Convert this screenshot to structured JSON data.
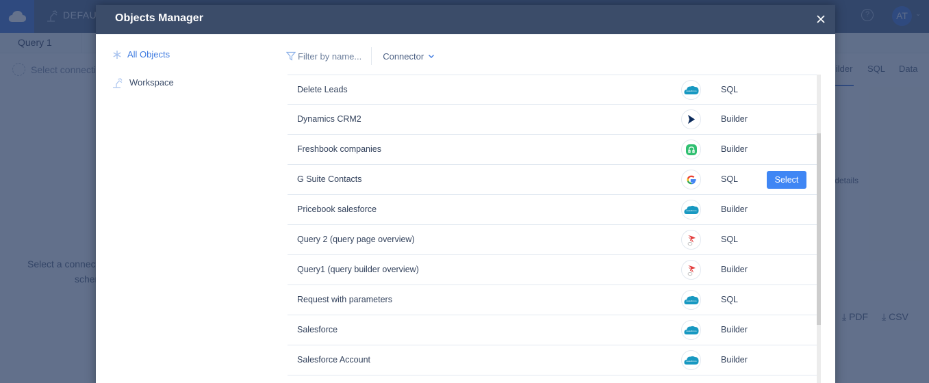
{
  "background_app": {
    "workspace_label": "DEFAULT",
    "help_label": "?",
    "avatar_initials": "AT",
    "query_tab": "Query 1",
    "select_connection": "Select connection",
    "view_tabs": [
      "Builder",
      "SQL",
      "Data"
    ],
    "hint_left_line1": "Select a connection",
    "hint_left_line2": "schema",
    "hint_right": "r details",
    "export_pdf": "PDF",
    "export_csv": "CSV"
  },
  "modal": {
    "title": "Objects Manager",
    "close_label": "×",
    "sidebar": {
      "items": [
        {
          "label": "All Objects",
          "icon": "asterisk-icon",
          "active": true
        },
        {
          "label": "Workspace",
          "icon": "desk-lamp-icon",
          "active": false
        }
      ]
    },
    "toolbar": {
      "filter_placeholder": "Filter by name...",
      "connector_label": "Connector"
    },
    "select_button_label": "Select",
    "rows": [
      {
        "name": "Delete Leads",
        "connector": "salesforce",
        "type": "SQL"
      },
      {
        "name": "Dynamics CRM2",
        "connector": "dynamics-crm",
        "type": "Builder"
      },
      {
        "name": "Freshbook companies",
        "connector": "freshbooks",
        "type": "Builder"
      },
      {
        "name": "G Suite Contacts",
        "connector": "google",
        "type": "SQL",
        "hovered": true
      },
      {
        "name": "Pricebook salesforce",
        "connector": "salesforce",
        "type": "Builder"
      },
      {
        "name": "Query 2 (query page overview)",
        "connector": "sql-server",
        "type": "SQL"
      },
      {
        "name": "Query1 (query builder overview)",
        "connector": "sql-server",
        "type": "Builder"
      },
      {
        "name": "Request with parameters",
        "connector": "salesforce",
        "type": "SQL"
      },
      {
        "name": "Salesforce",
        "connector": "salesforce",
        "type": "Builder"
      },
      {
        "name": "Salesforce Account",
        "connector": "salesforce",
        "type": "Builder"
      }
    ]
  },
  "colors": {
    "accent": "#3f86f4",
    "header": "#3b4c69",
    "active_link": "#3f7be0"
  }
}
